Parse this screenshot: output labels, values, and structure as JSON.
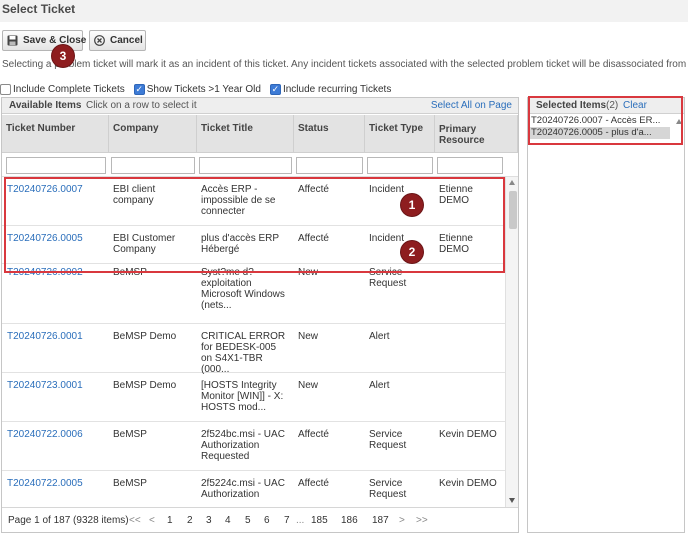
{
  "dialog": {
    "title": "Select Ticket"
  },
  "toolbar": {
    "save_label": "Save & Close",
    "cancel_label": "Cancel"
  },
  "description": "Selecting a problem ticket will mark it as an incident of this ticket. Any incident tickets associated with the selected problem ticket will be disassociated from them an",
  "options": [
    {
      "label": "Include Complete Tickets",
      "checked": false
    },
    {
      "label": "Show Tickets >1 Year Old",
      "checked": true
    },
    {
      "label": "Include recurring Tickets",
      "checked": true
    }
  ],
  "available": {
    "title": "Available Items",
    "hint": "Click on a row to select it",
    "select_all": "Select All on Page",
    "columns": [
      "Ticket Number",
      "Company",
      "Ticket Title",
      "Status",
      "Ticket Type",
      "Primary Resource"
    ],
    "rows": [
      {
        "number": "T20240726.0007",
        "company": "EBI client company",
        "title": "Accès ERP - impossible de se connecter",
        "status": "Affecté",
        "type": "Incident",
        "resource": "Etienne DEMO"
      },
      {
        "number": "T20240726.0005",
        "company": "EBI Customer Company",
        "title": "plus d'accès ERP Hébergé",
        "status": "Affecté",
        "type": "Incident",
        "resource": "Etienne DEMO"
      },
      {
        "number": "T20240726.0002",
        "company": "BeMSP",
        "title": "Syst?me d? exploitation Microsoft Windows (nets...",
        "status": "New",
        "type": "Service Request",
        "resource": ""
      },
      {
        "number": "T20240726.0001",
        "company": "BeMSP Demo",
        "title": "CRITICAL ERROR for BEDESK-005 on S4X1-TBR (000...",
        "status": "New",
        "type": "Alert",
        "resource": ""
      },
      {
        "number": "T20240723.0001",
        "company": "BeMSP Demo",
        "title": "[HOSTS Integrity Monitor [WIN]] - X: HOSTS mod...",
        "status": "New",
        "type": "Alert",
        "resource": ""
      },
      {
        "number": "T20240722.0006",
        "company": "BeMSP",
        "title": "2f524bc.msi - UAC Authorization Requested",
        "status": "Affecté",
        "type": "Service Request",
        "resource": "Kevin DEMO"
      },
      {
        "number": "T20240722.0005",
        "company": "BeMSP",
        "title": "2f5224c.msi - UAC Authorization",
        "status": "Affecté",
        "type": "Service Request",
        "resource": "Kevin DEMO"
      }
    ]
  },
  "pager": {
    "summary": "Page 1 of 187 (9328 items)",
    "first": "<<",
    "prev": "<",
    "pages": [
      "1",
      "2",
      "3",
      "4",
      "5",
      "6",
      "7"
    ],
    "ellipsis": "...",
    "last_pages": [
      "185",
      "186",
      "187"
    ],
    "next": ">",
    "last": ">>"
  },
  "selected": {
    "title": "Selected Items",
    "count": "(2)",
    "clear": "Clear",
    "items": [
      "T20240726.0007 - Accès ER...",
      "T20240726.0005 - plus d'a..."
    ]
  },
  "markers": [
    "1",
    "2",
    "3"
  ],
  "colors": {
    "link": "#2a6ebb",
    "highlight": "#d9383e",
    "marker": "#8e1d1f",
    "checkbox": "#3d7bd6"
  }
}
